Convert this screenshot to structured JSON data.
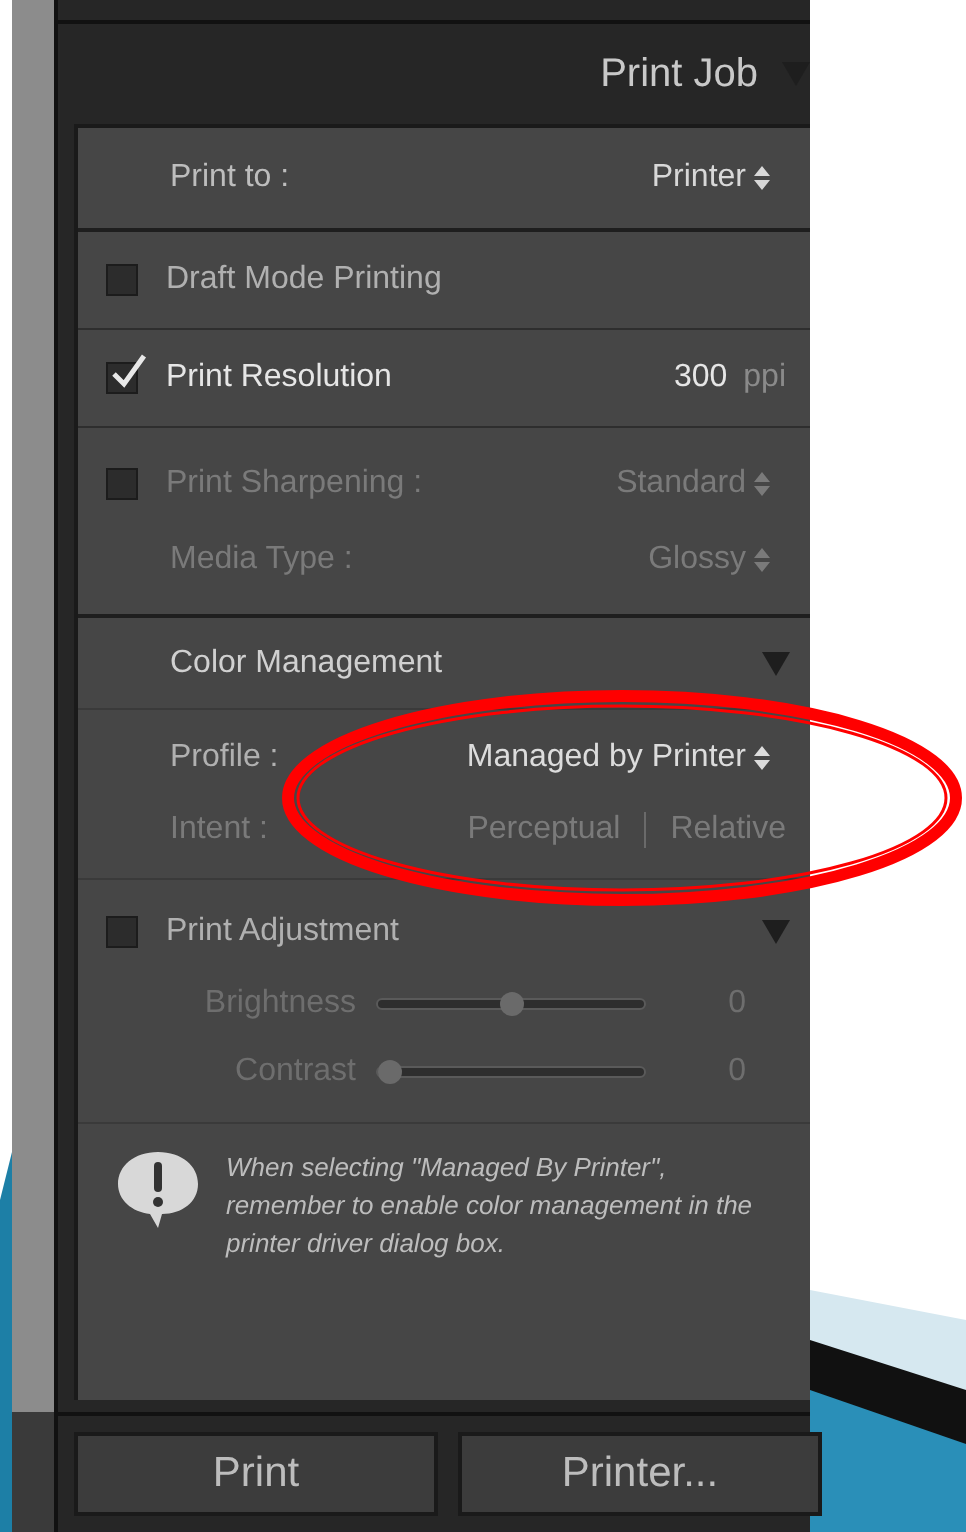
{
  "panel": {
    "title": "Print Job"
  },
  "print_to": {
    "label": "Print to :",
    "value": "Printer"
  },
  "options": [
    {
      "kind": "check",
      "label": "Draft Mode Printing",
      "checked": false
    },
    {
      "kind": "resolution",
      "label": "Print Resolution",
      "checked": true,
      "value": "300",
      "unit": "ppi"
    }
  ],
  "sharpening": {
    "label": "Print Sharpening :",
    "checked": false,
    "value": "Standard",
    "disabled": true
  },
  "media_type": {
    "label": "Media Type :",
    "value": "Glossy",
    "disabled": true
  },
  "color_management": {
    "title": "Color Management",
    "profile": {
      "label": "Profile :",
      "value": "Managed by Printer"
    },
    "intent": {
      "label": "Intent :",
      "disabled": true,
      "options": [
        {
          "label": "Perceptual",
          "selected": false
        },
        {
          "label": "Relative",
          "selected": false
        }
      ]
    }
  },
  "print_adjustment": {
    "label": "Print Adjustment",
    "checked": false,
    "sliders": [
      {
        "label": "Brightness",
        "level": 0.5,
        "reading": "0"
      },
      {
        "label": "Contrast",
        "level": 0.05,
        "reading": "0"
      }
    ]
  },
  "note": "When selecting \"Managed By Printer\", remember to enable color management in the printer driver dialog box.",
  "buttons": [
    {
      "label": "Print"
    },
    {
      "label": "Printer..."
    }
  ]
}
